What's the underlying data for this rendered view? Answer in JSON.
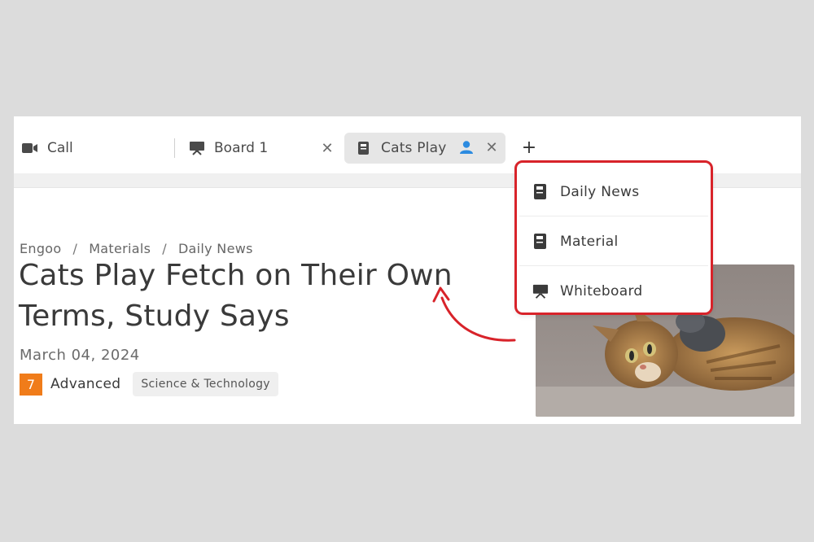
{
  "tabs": {
    "call": {
      "label": "Call",
      "icon": "video-camera-icon"
    },
    "board": {
      "label": "Board 1",
      "icon": "whiteboard-icon",
      "close": "✕"
    },
    "cats": {
      "label": "Cats Play",
      "icon": "book-icon",
      "close": "✕",
      "user_icon": "user-icon"
    },
    "add": "+"
  },
  "dropdown": {
    "items": [
      {
        "label": "Daily News",
        "icon": "book-icon"
      },
      {
        "label": "Material",
        "icon": "book-icon"
      },
      {
        "label": "Whiteboard",
        "icon": "whiteboard-icon"
      }
    ],
    "highlight_color": "#d8232a"
  },
  "breadcrumb": [
    "Engoo",
    "Materials",
    "Daily News"
  ],
  "breadcrumb_separator": "/",
  "article": {
    "title": "Cats Play Fetch on Their Own Terms, Study Says",
    "date": "March 04, 2024",
    "level_number": "7",
    "level_label": "Advanced",
    "category": "Science & Technology"
  },
  "colors": {
    "level_badge": "#f07c1a",
    "user_icon": "#2c8be0",
    "active_tab_bg": "#e6e6e6"
  }
}
